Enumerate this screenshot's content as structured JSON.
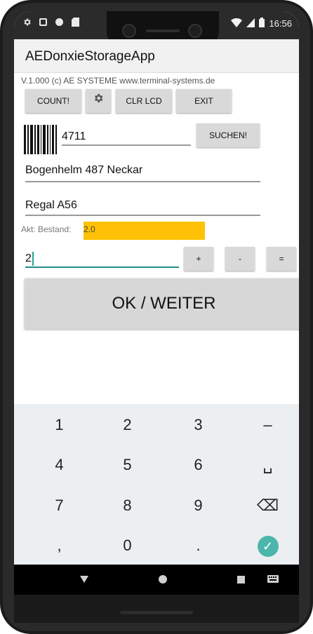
{
  "status_bar": {
    "time": "16:56",
    "left_icons": [
      "gear-icon",
      "a-icon",
      "dot-icon",
      "sdcard-icon"
    ],
    "right_icons": [
      "wifi-icon",
      "signal-icon",
      "battery-icon"
    ]
  },
  "app": {
    "title": "AEDonxieStorageApp",
    "version": "V.1.000 (c) AE SYSTEME www.terminal-systems.de"
  },
  "toolbar": {
    "count_label": "COUNT!",
    "settings_icon": "gear-icon",
    "clr_lcd_label": "CLR LCD",
    "exit_label": "EXIT"
  },
  "search": {
    "barcode_value": "4711",
    "button_label": "SUCHEN!"
  },
  "item": {
    "name": "Bogenhelm 487 Neckar",
    "location": "Regal A56"
  },
  "stock": {
    "label": "Akt: Bestand:",
    "value": "2.0",
    "highlight_color": "#ffc107"
  },
  "quantity": {
    "value": "2",
    "plus_label": "+",
    "minus_label": "-",
    "equals_label": "="
  },
  "ok_button": {
    "label": "OK / WEITER"
  },
  "keyboard": {
    "rows": [
      [
        "1",
        "2",
        "3",
        "–"
      ],
      [
        "4",
        "5",
        "6",
        "␣"
      ],
      [
        "7",
        "8",
        "9",
        "⌫"
      ],
      [
        ",",
        "0",
        ".",
        "✓"
      ]
    ],
    "accent_color": "#4db6ac"
  },
  "navbar": {
    "icons": [
      "back-icon",
      "home-icon",
      "recents-icon",
      "keyboard-icon"
    ]
  }
}
